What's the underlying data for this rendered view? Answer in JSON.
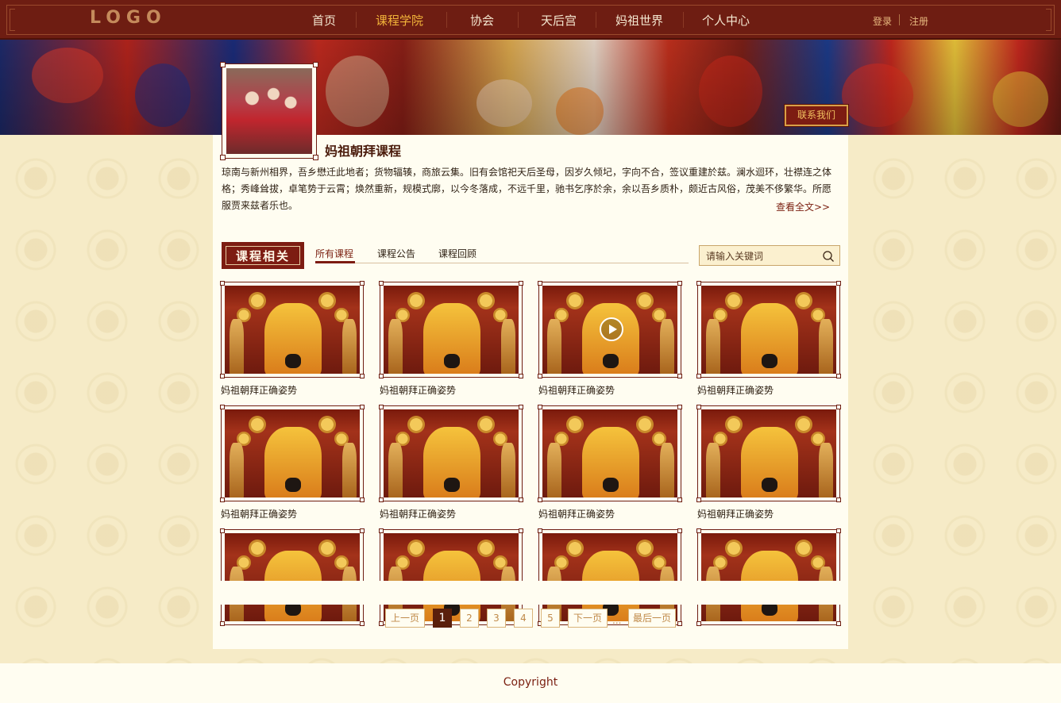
{
  "header": {
    "logo": "LOGO",
    "nav": [
      {
        "label": "首页",
        "active": false
      },
      {
        "label": "课程学院",
        "active": true
      },
      {
        "label": "协会",
        "active": false
      },
      {
        "label": "天后宫",
        "active": false
      },
      {
        "label": "妈祖世界",
        "active": false
      },
      {
        "label": "个人中心",
        "active": false
      }
    ],
    "login": "登录",
    "register": "注册"
  },
  "banner": {
    "contact": "联系我们"
  },
  "course": {
    "title": "妈祖朝拜课程",
    "description": "琼南与新州相界，吾乡懋迁此地者；货物辐辏，商旅云集。旧有会馆祀天后圣母，因岁久倾圮，字向不合，签议重建於兹。澜水迴环，壮襟连之体格；秀峰耸拔，卓笔势于云霄；焕然重新，规模式廓，以今冬落成，不远千里，驰书乞序於余，余以吾乡质朴，颇近古风俗，茂美不侈繁华。所愿服贾来兹者乐也。",
    "read_more": "查看全文>>"
  },
  "section": {
    "badge": "课程相关",
    "tabs": [
      {
        "label": "所有课程",
        "active": true
      },
      {
        "label": "课程公告",
        "active": false
      },
      {
        "label": "课程回顾",
        "active": false
      }
    ],
    "search_placeholder": "请输入关键词",
    "search_icon": "search-icon"
  },
  "cards": [
    {
      "title": "妈祖朝拜正确姿势",
      "video": false
    },
    {
      "title": "妈祖朝拜正确姿势",
      "video": false
    },
    {
      "title": "妈祖朝拜正确姿势",
      "video": true
    },
    {
      "title": "妈祖朝拜正确姿势",
      "video": false
    },
    {
      "title": "妈祖朝拜正确姿势",
      "video": false
    },
    {
      "title": "妈祖朝拜正确姿势",
      "video": false
    },
    {
      "title": "妈祖朝拜正确姿势",
      "video": false
    },
    {
      "title": "妈祖朝拜正确姿势",
      "video": false
    },
    {
      "title": "",
      "video": false
    },
    {
      "title": "",
      "video": false
    },
    {
      "title": "",
      "video": false
    },
    {
      "title": "",
      "video": false
    }
  ],
  "pagination": {
    "prev": "上一页",
    "pages": [
      "1",
      "2",
      "3",
      "4",
      "5"
    ],
    "current": "1",
    "next": "下一页",
    "ellipsis": "...",
    "last": "最后一页"
  },
  "footer": {
    "copyright": "Copyright"
  },
  "colors": {
    "brand": "#6e1d12",
    "accent": "#f2b43a",
    "background": "#f6ebc7",
    "panel": "#fffdf1"
  }
}
